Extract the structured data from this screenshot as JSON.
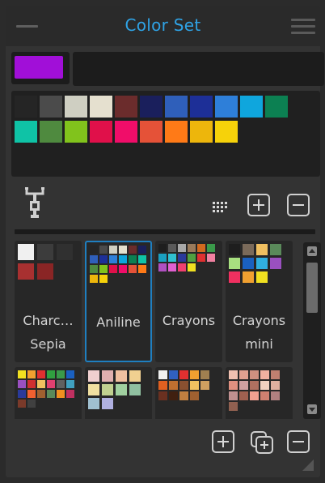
{
  "title": "Color Set",
  "current_color": "#a10fd8",
  "color_name_value": "",
  "swatch_colors": [
    "#252525",
    "#4b4b4b",
    "#cfcfc2",
    "#e5e0cf",
    "#6b2c2c",
    "#1a1f5c",
    "#2f5fba",
    "#1d2f97",
    "#2e7fd9",
    "#0fa6dd",
    "#0c8052",
    "#0fc3a6",
    "#4f8a3f",
    "#81c31c",
    "#e0104a",
    "#f00d69",
    "#e55238",
    "#ff7a17",
    "#edb60c",
    "#f6d20a"
  ],
  "color_sets": [
    {
      "name": "Charc…\nSepia",
      "label_line1": "Charc…",
      "label_line2": "Sepia",
      "selected": false,
      "thumb": [
        "#f0f0f0",
        "#3c3c3c",
        "#303030",
        "#a83030",
        "#8a2525"
      ]
    },
    {
      "name": "Aniline",
      "label_line1": "Aniline",
      "label_line2": "",
      "selected": true,
      "thumb": [
        "#252525",
        "#4b4b4b",
        "#cfcfc2",
        "#e5e0cf",
        "#6b2c2c",
        "#1a1f5c",
        "#2f5fba",
        "#1d2f97",
        "#2e7fd9",
        "#0fa6dd",
        "#0c8052",
        "#0fc3a6",
        "#4f8a3f",
        "#81c31c",
        "#e0104a",
        "#f00d69",
        "#e55238",
        "#ff7a17",
        "#edb60c",
        "#f6d20a"
      ]
    },
    {
      "name": "Crayons",
      "label_line1": "Crayons",
      "label_line2": "",
      "selected": false,
      "thumb": [
        "#1e1e1e",
        "#5a5a5a",
        "#a8a8a8",
        "#9a7a5a",
        "#d2691e",
        "#3a9a4a",
        "#1aa0c0",
        "#30c0d0",
        "#2a3a9a",
        "#50a040",
        "#e03030",
        "#f080a0",
        "#b050c0",
        "#e060d0",
        "#f04070",
        "#f0e020"
      ]
    },
    {
      "name": "Crayons mini",
      "label_line1": "Crayons",
      "label_line2": "mini",
      "selected": false,
      "thumb": [
        "#1e1e1e",
        "#7a6a5a",
        "#f0c060",
        "#5a8a5a",
        "#a8e080",
        "#1a60c0",
        "#30b0e0",
        "#9a50c0",
        "#f03060",
        "#f0a030",
        "#f0e020"
      ]
    },
    {
      "name": "",
      "label_line1": "",
      "label_line2": "",
      "selected": false,
      "thumb": [
        "#f0e020",
        "#f0a030",
        "#e03030",
        "#30a040",
        "#3a9a4a",
        "#1a60c0",
        "#9a50c0",
        "#d03030",
        "#f0c060",
        "#e04070",
        "#606060",
        "#40a0c0",
        "#2a3a9a",
        "#f06030",
        "#a06030",
        "#5a8a5a",
        "#f09020",
        "#c03060",
        "#7a3a2a",
        "#404040"
      ]
    },
    {
      "name": "",
      "label_line1": "",
      "label_line2": "",
      "selected": false,
      "thumb": [
        "#f0d0d0",
        "#e0b0b0",
        "#f0c0a0",
        "#f0d090",
        "#f0e0a0",
        "#c0d090",
        "#a0d0a0",
        "#90c0a0",
        "#a0c0d0",
        "#b0b0e0"
      ]
    },
    {
      "name": "",
      "label_line1": "",
      "label_line2": "",
      "selected": false,
      "thumb": [
        "#f0f0f0",
        "#3060c0",
        "#e03030",
        "#f0a030",
        "#a08050",
        "#e06020",
        "#c07030",
        "#8a5030",
        "#f0c060",
        "#d0a060",
        "#6a3020",
        "#402010",
        "#c08040",
        "#a06030"
      ]
    },
    {
      "name": "",
      "label_line1": "",
      "label_line2": "",
      "selected": false,
      "thumb": [
        "#f0c0b0",
        "#e0a090",
        "#d09080",
        "#f0b0a0",
        "#c08070",
        "#e09080",
        "#d0a0a0",
        "#b07060",
        "#f0d0c0",
        "#e0b0a0",
        "#c09090",
        "#a06050",
        "#f0a090",
        "#d08070",
        "#b08080",
        "#906050"
      ]
    }
  ],
  "icons": {
    "tree": "node-tree-icon",
    "grid": "swatch-grid-icon",
    "add": "plus-icon",
    "remove": "minus-icon",
    "duplicate": "duplicate-icon"
  }
}
